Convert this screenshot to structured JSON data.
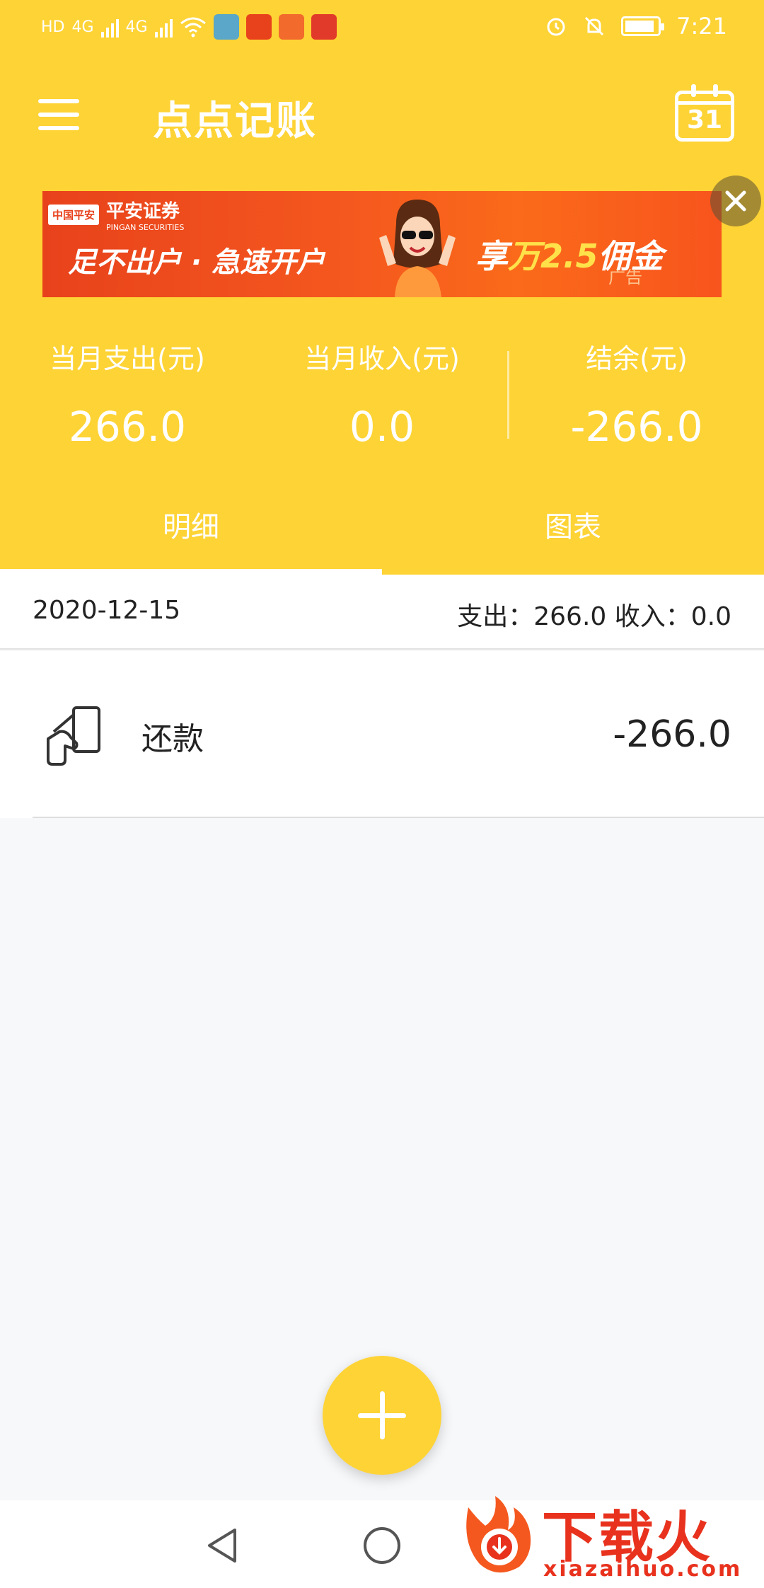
{
  "status_bar": {
    "left_badges": [
      "HD",
      "4G",
      "4G"
    ],
    "time": "7:21"
  },
  "toolbar": {
    "title": "点点记账",
    "calendar_day": "31"
  },
  "ad": {
    "brand_logo": "中国平安",
    "brand_name": "平安证券",
    "brand_sub": "PINGAN SECURITIES",
    "headline": "足不出户 · 急速开户",
    "offer_prefix": "享",
    "offer_highlight": "万2.5",
    "offer_suffix": "佣金",
    "tag": "广告"
  },
  "summary": {
    "expense_label": "当月支出(元)",
    "expense_value": "266.0",
    "income_label": "当月收入(元)",
    "income_value": "0.0",
    "balance_label": "结余(元)",
    "balance_value": "-266.0"
  },
  "tabs": [
    {
      "label": "明细",
      "active": true
    },
    {
      "label": "图表",
      "active": false
    }
  ],
  "list": {
    "date": "2020-12-15",
    "day_summary": "支出：266.0 收入：0.0",
    "entries": [
      {
        "icon": "card-repayment-icon",
        "label": "还款",
        "amount": "-266.0"
      }
    ]
  },
  "watermark": {
    "title": "下载火",
    "url": "xiazaihuo.com"
  },
  "colors": {
    "primary": "#fed335",
    "ad_orange": "#f5581e",
    "watermark_red": "#e8321e"
  }
}
